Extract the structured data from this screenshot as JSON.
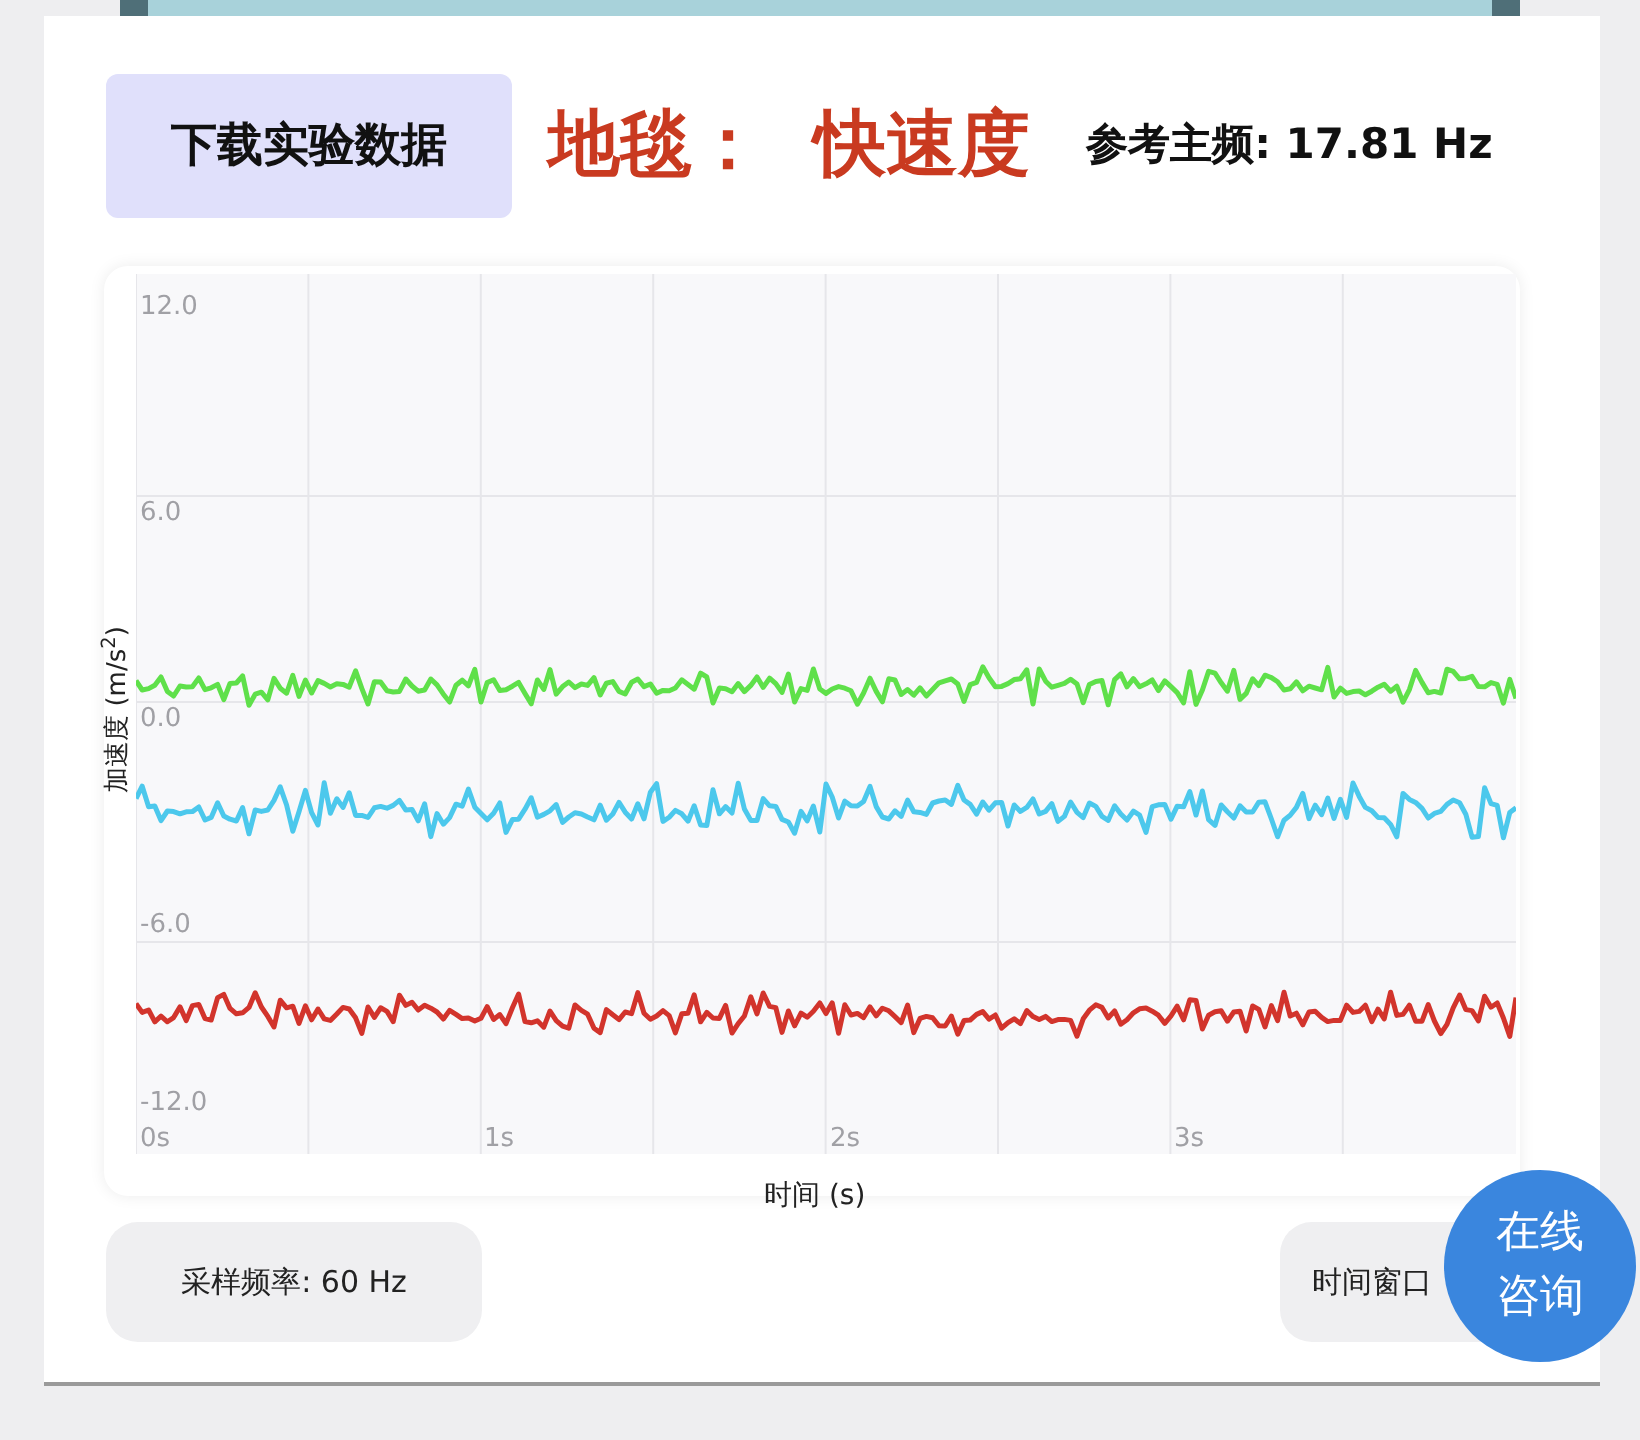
{
  "header": {
    "download_button": "下载实验数据",
    "title": "地毯：  快速度",
    "reference_frequency": "参考主频: 17.81 Hz"
  },
  "chart": {
    "ylabel": "加速度 (m/s$^{2}$)",
    "xlabel": "时间 (s)",
    "yticks": [
      "12.0",
      "6.0",
      "0.0",
      "-6.0",
      "-12.0"
    ],
    "xticks": [
      "0s",
      "1s",
      "2s",
      "3s"
    ],
    "traces": [
      {
        "color": "#5fe04a"
      },
      {
        "color": "#4cc8ec"
      },
      {
        "color": "#d2342c"
      }
    ]
  },
  "footer": {
    "sample_rate": "采样频率: 60 Hz",
    "time_window": "时间窗口",
    "consult_button": "在线咨询"
  }
}
